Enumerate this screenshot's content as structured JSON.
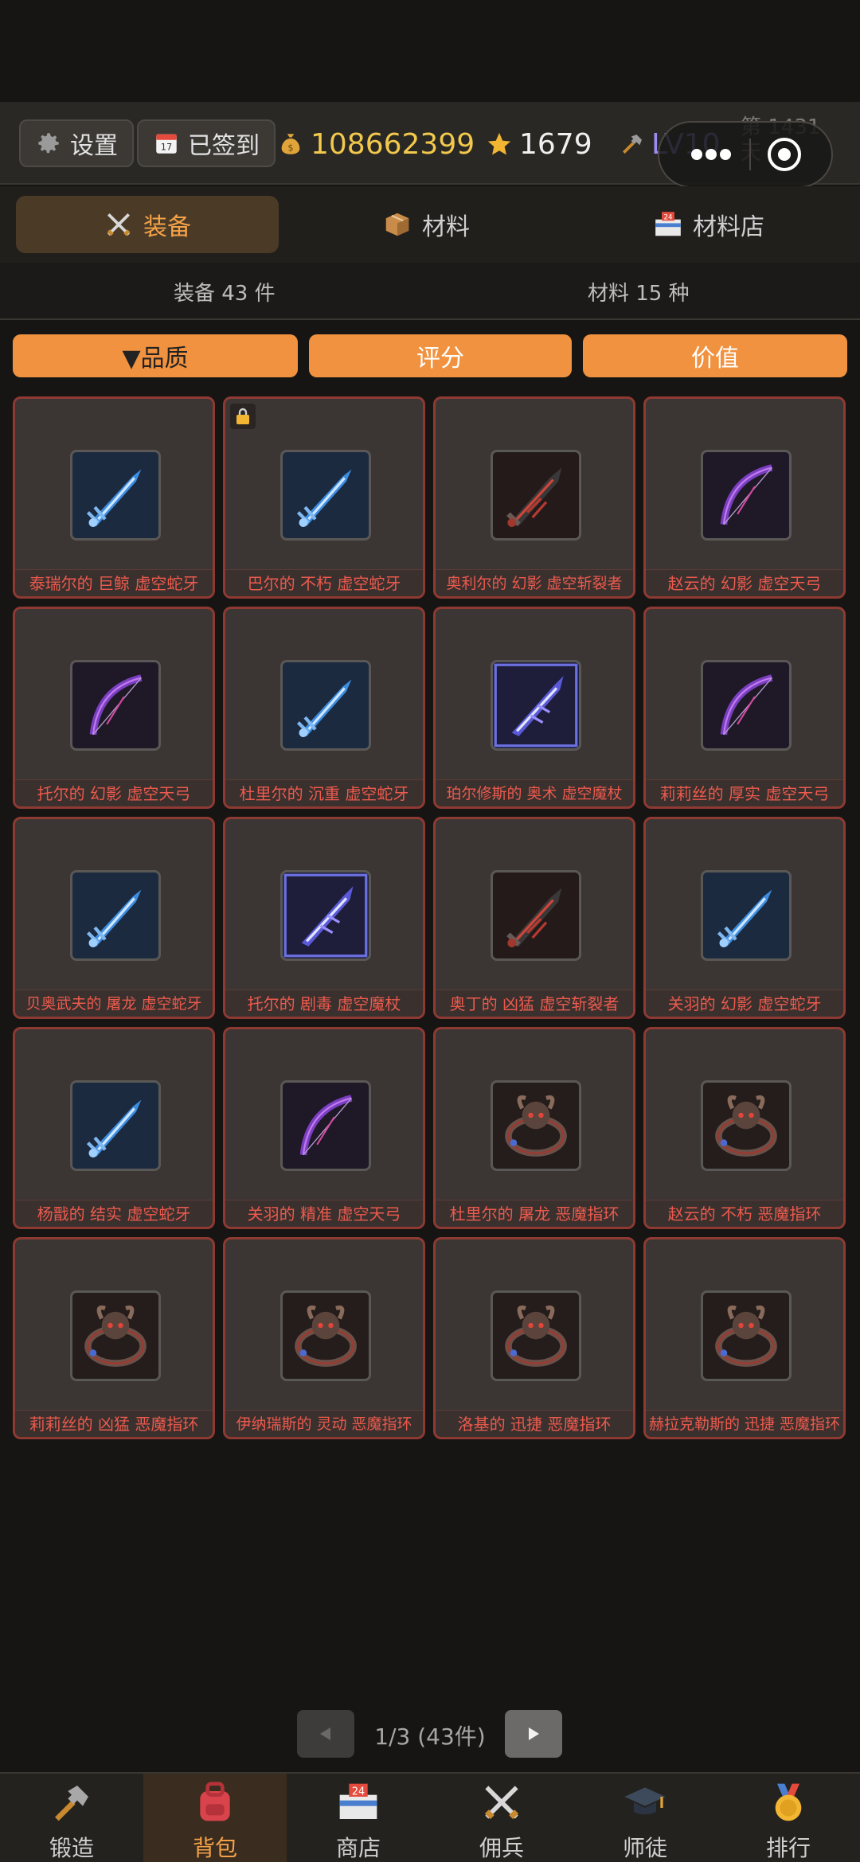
{
  "topbar": {
    "settings_label": "设置",
    "signin_label": "已签到",
    "gold": "108662399",
    "stars": "1679",
    "level": "LV10",
    "day_label": "第 1431 天"
  },
  "tabs": [
    {
      "label": "装备",
      "icon": "crossed-swords-icon",
      "active": true
    },
    {
      "label": "材料",
      "icon": "package-icon",
      "active": false
    },
    {
      "label": "材料店",
      "icon": "convenience-store-icon",
      "active": false
    }
  ],
  "counts": {
    "equipment": "装备 43 件",
    "materials": "材料 15 种"
  },
  "sort": {
    "quality": "▼品质",
    "score": "评分",
    "value": "价值"
  },
  "items": [
    {
      "name": "泰瑞尔的 巨鲸 虚空蛇牙",
      "icon": "serpent-fang-icon"
    },
    {
      "name": "巴尔的 不朽 虚空蛇牙",
      "icon": "serpent-fang-icon",
      "locked": true
    },
    {
      "name": "奥利尔的 幻影 虚空斩裂者",
      "icon": "void-cleaver-icon"
    },
    {
      "name": "赵云的 幻影 虚空天弓",
      "icon": "void-bow-icon"
    },
    {
      "name": "托尔的 幻影 虚空天弓",
      "icon": "void-bow-icon"
    },
    {
      "name": "杜里尔的 沉重 虚空蛇牙",
      "icon": "serpent-fang-icon"
    },
    {
      "name": "珀尔修斯的 奥术 虚空魔杖",
      "icon": "void-wand-icon"
    },
    {
      "name": "莉莉丝的 厚实 虚空天弓",
      "icon": "void-bow-icon"
    },
    {
      "name": "贝奥武夫的 屠龙 虚空蛇牙",
      "icon": "serpent-fang-icon"
    },
    {
      "name": "托尔的 剧毒 虚空魔杖",
      "icon": "void-wand-icon"
    },
    {
      "name": "奥丁的 凶猛 虚空斩裂者",
      "icon": "void-cleaver-icon"
    },
    {
      "name": "关羽的 幻影 虚空蛇牙",
      "icon": "serpent-fang-icon"
    },
    {
      "name": "杨戬的 结实 虚空蛇牙",
      "icon": "serpent-fang-icon"
    },
    {
      "name": "关羽的 精准 虚空天弓",
      "icon": "void-bow-icon"
    },
    {
      "name": "杜里尔的 屠龙 恶魔指环",
      "icon": "demon-ring-icon"
    },
    {
      "name": "赵云的 不朽 恶魔指环",
      "icon": "demon-ring-icon"
    },
    {
      "name": "莉莉丝的 凶猛 恶魔指环",
      "icon": "demon-ring-icon"
    },
    {
      "name": "伊纳瑞斯的 灵动 恶魔指环",
      "icon": "demon-ring-icon"
    },
    {
      "name": "洛基的 迅捷 恶魔指环",
      "icon": "demon-ring-icon"
    },
    {
      "name": "赫拉克勒斯的 迅捷 恶魔指环",
      "icon": "demon-ring-icon"
    }
  ],
  "pager": {
    "text": "1/3  (43件)"
  },
  "bottom_nav": [
    {
      "label": "锻造",
      "icon": "hammer-icon"
    },
    {
      "label": "背包",
      "icon": "backpack-icon",
      "active": true
    },
    {
      "label": "商店",
      "icon": "shop-icon"
    },
    {
      "label": "佣兵",
      "icon": "crossed-swords-icon"
    },
    {
      "label": "师徒",
      "icon": "graduation-cap-icon"
    },
    {
      "label": "排行",
      "icon": "medal-icon"
    }
  ],
  "colors": {
    "accent": "#f0923f",
    "item_name": "#ec5a4e",
    "gold": "#f2c94c",
    "level": "#9a8cf0"
  }
}
